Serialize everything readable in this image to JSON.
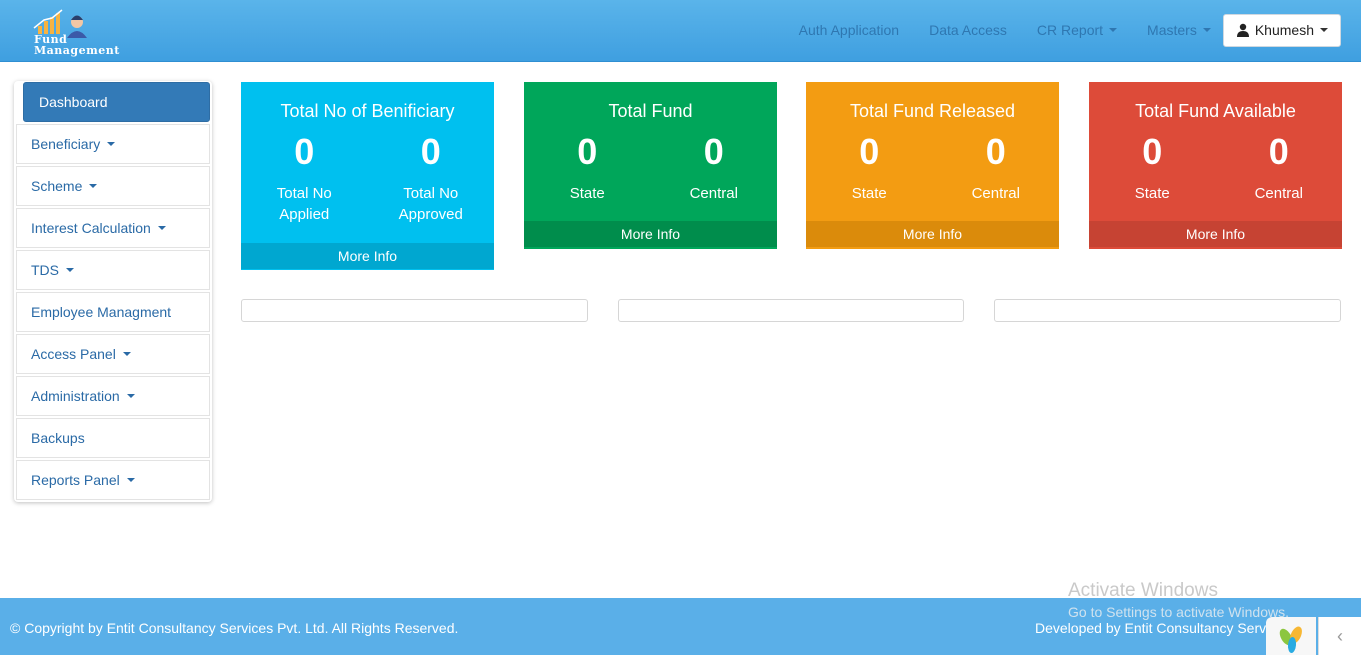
{
  "brand": {
    "line1": "Fund",
    "line2": "Management"
  },
  "nav": {
    "items": [
      {
        "label": "Auth Application"
      },
      {
        "label": "Data Access"
      },
      {
        "label": "CR Report"
      },
      {
        "label": "Masters"
      }
    ],
    "user": "Khumesh"
  },
  "sidebar": {
    "items": [
      {
        "label": "Dashboard"
      },
      {
        "label": "Beneficiary"
      },
      {
        "label": "Scheme"
      },
      {
        "label": "Interest Calculation"
      },
      {
        "label": "TDS"
      },
      {
        "label": "Employee Managment"
      },
      {
        "label": "Access Panel"
      },
      {
        "label": "Administration"
      },
      {
        "label": "Backups"
      },
      {
        "label": "Reports Panel"
      }
    ]
  },
  "cards": [
    {
      "title": "Total No of Benificiary",
      "left_value": "0",
      "left_label_1": "Total No",
      "left_label_2": "Applied",
      "right_value": "0",
      "right_label_1": "Total No",
      "right_label_2": "Approved",
      "footer": "More Info",
      "color": "#00c0ef"
    },
    {
      "title": "Total Fund",
      "left_value": "0",
      "left_label": "State",
      "right_value": "0",
      "right_label": "Central",
      "footer": "More Info",
      "color": "#00a65a"
    },
    {
      "title": "Total Fund Released",
      "left_value": "0",
      "left_label": "State",
      "right_value": "0",
      "right_label": "Central",
      "footer": "More Info",
      "color": "#f39c12"
    },
    {
      "title": "Total Fund Available",
      "left_value": "0",
      "left_label": "State",
      "right_value": "0",
      "right_label": "Central",
      "footer": "More Info",
      "color": "#dd4b39"
    }
  ],
  "watermark": {
    "title": "Activate Windows",
    "subtitle": "Go to Settings to activate Windows."
  },
  "footer": {
    "copyright": "© Copyright by Entit Consultancy Services Pvt. Ltd. All Rights Reserved.",
    "developed": "Developed by Entit Consultancy Serv"
  },
  "colors": {
    "header": "#4aa8e6",
    "footer": "#5aafe8",
    "active": "#337ab7"
  }
}
